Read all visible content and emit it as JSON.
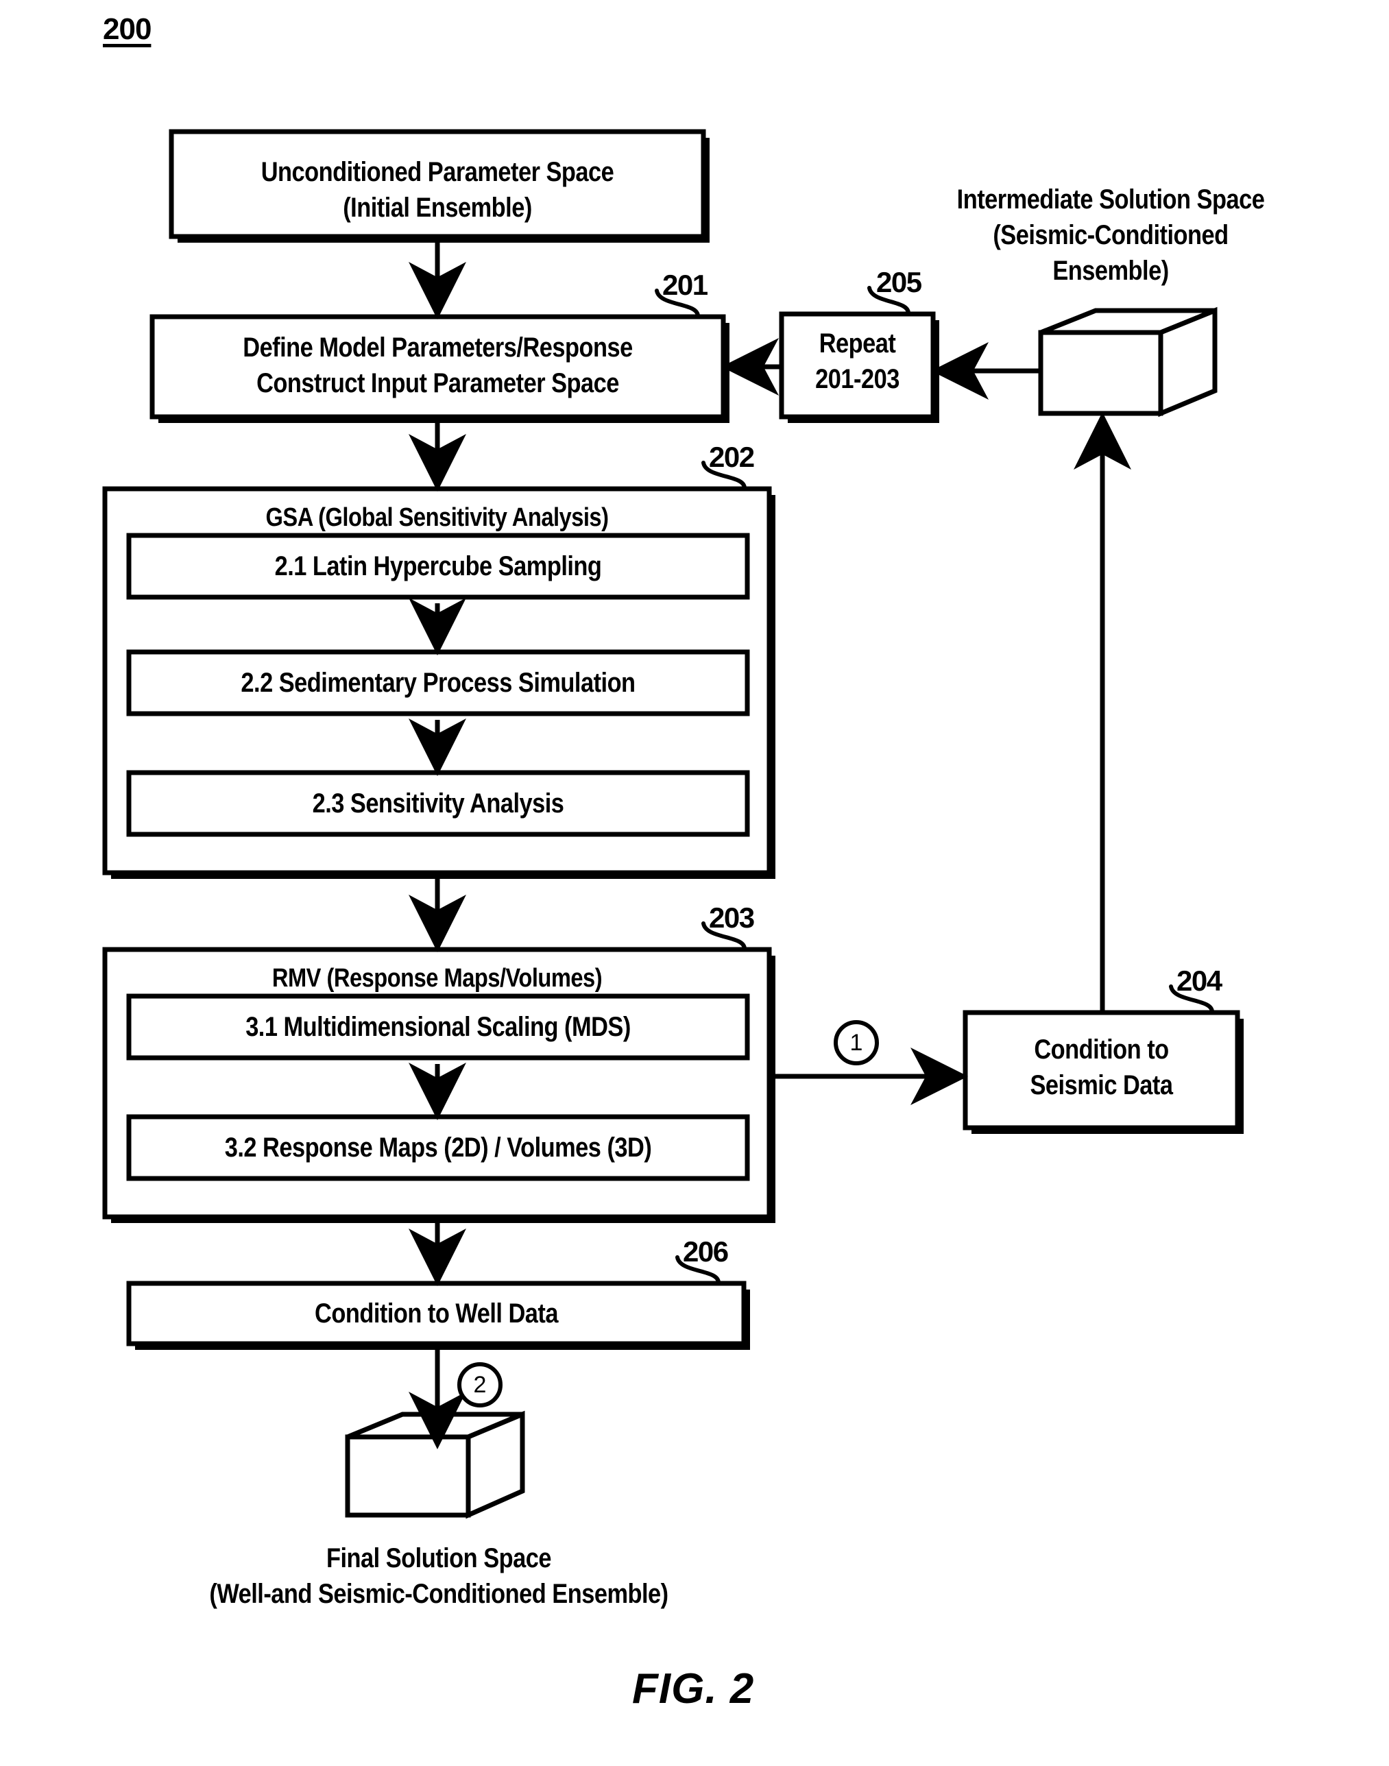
{
  "figure": {
    "number_label": "200",
    "caption": "FIG. 2"
  },
  "nodes": {
    "unconditioned": {
      "line1": "Unconditioned Parameter Space",
      "line2": "(Initial Ensemble)"
    },
    "define_model": {
      "ref": "201",
      "line1": "Define Model Parameters/Response",
      "line2": "Construct Input Parameter Space"
    },
    "repeat": {
      "ref": "205",
      "line1": "Repeat",
      "line2": "201-203"
    },
    "intermediate_solution": {
      "line1": "Intermediate Solution Space",
      "line2": "(Seismic-Conditioned",
      "line3": "Ensemble)"
    },
    "gsa": {
      "ref": "202",
      "title": "GSA (Global Sensitivity Analysis)",
      "steps": [
        "2.1 Latin Hypercube Sampling",
        "2.2 Sedimentary Process Simulation",
        "2.3 Sensitivity Analysis"
      ]
    },
    "rmv": {
      "ref": "203",
      "title": "RMV (Response Maps/Volumes)",
      "steps": [
        "3.1 Multidimensional Scaling (MDS)",
        "3.2 Response Maps (2D) / Volumes (3D)"
      ]
    },
    "condition_seismic": {
      "ref": "204",
      "line1": "Condition to",
      "line2": "Seismic Data"
    },
    "condition_well": {
      "ref": "206",
      "line1": "Condition to Well Data"
    },
    "final_solution": {
      "line1": "Final Solution Space",
      "line2": "(Well-and Seismic-Conditioned Ensemble)"
    }
  },
  "connectors": {
    "marker_one": "1",
    "marker_two": "2"
  },
  "colors": {
    "ink": "#000000",
    "paper": "#ffffff"
  }
}
